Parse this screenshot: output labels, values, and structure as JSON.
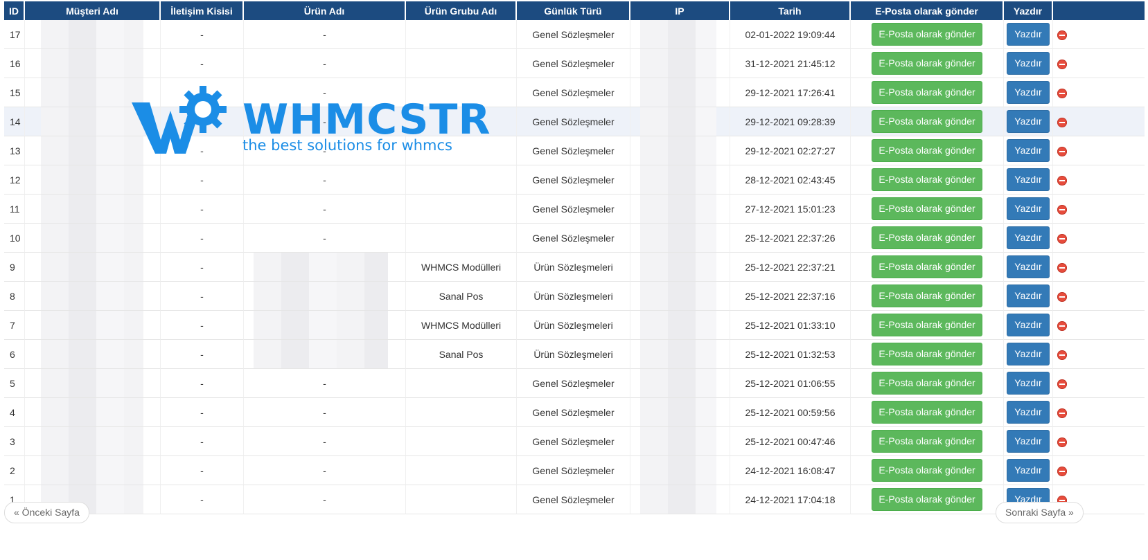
{
  "columns": [
    "ID",
    "Müşteri Adı",
    "İletişim Kisisi",
    "Ürün Adı",
    "Ürün Grubu Adı",
    "Günlük Türü",
    "IP",
    "Tarih",
    "E-Posta olarak gönder",
    "Yazdır",
    ""
  ],
  "rows": [
    {
      "id": "17",
      "contact": "-",
      "product": "-",
      "group": "",
      "type": "Genel Sözleşmeler",
      "date": "02-01-2022 19:09:44"
    },
    {
      "id": "16",
      "contact": "-",
      "product": "-",
      "group": "",
      "type": "Genel Sözleşmeler",
      "date": "31-12-2021 21:45:12"
    },
    {
      "id": "15",
      "contact": "-",
      "product": "-",
      "group": "",
      "type": "Genel Sözleşmeler",
      "date": "29-12-2021 17:26:41"
    },
    {
      "id": "14",
      "contact": "-",
      "product": "-",
      "group": "",
      "type": "Genel Sözleşmeler",
      "date": "29-12-2021 09:28:39"
    },
    {
      "id": "13",
      "contact": "-",
      "product": "-",
      "group": "",
      "type": "Genel Sözleşmeler",
      "date": "29-12-2021 02:27:27"
    },
    {
      "id": "12",
      "contact": "-",
      "product": "-",
      "group": "",
      "type": "Genel Sözleşmeler",
      "date": "28-12-2021 02:43:45"
    },
    {
      "id": "11",
      "contact": "-",
      "product": "-",
      "group": "",
      "type": "Genel Sözleşmeler",
      "date": "27-12-2021 15:01:23"
    },
    {
      "id": "10",
      "contact": "-",
      "product": "-",
      "group": "",
      "type": "Genel Sözleşmeler",
      "date": "25-12-2021 22:37:26"
    },
    {
      "id": "9",
      "contact": "-",
      "product": "",
      "group": "WHMCS Modülleri",
      "type": "Ürün Sözleşmeleri",
      "date": "25-12-2021 22:37:21"
    },
    {
      "id": "8",
      "contact": "-",
      "product": "",
      "group": "Sanal Pos",
      "type": "Ürün Sözleşmeleri",
      "date": "25-12-2021 22:37:16"
    },
    {
      "id": "7",
      "contact": "-",
      "product": "",
      "group": "WHMCS Modülleri",
      "type": "Ürün Sözleşmeleri",
      "date": "25-12-2021 01:33:10"
    },
    {
      "id": "6",
      "contact": "-",
      "product": "",
      "group": "Sanal Pos",
      "type": "Ürün Sözleşmeleri",
      "date": "25-12-2021 01:32:53"
    },
    {
      "id": "5",
      "contact": "-",
      "product": "-",
      "group": "",
      "type": "Genel Sözleşmeler",
      "date": "25-12-2021 01:06:55"
    },
    {
      "id": "4",
      "contact": "-",
      "product": "-",
      "group": "",
      "type": "Genel Sözleşmeler",
      "date": "25-12-2021 00:59:56"
    },
    {
      "id": "3",
      "contact": "-",
      "product": "-",
      "group": "",
      "type": "Genel Sözleşmeler",
      "date": "25-12-2021 00:47:46"
    },
    {
      "id": "2",
      "contact": "-",
      "product": "-",
      "group": "",
      "type": "Genel Sözleşmeler",
      "date": "24-12-2021 16:08:47"
    },
    {
      "id": "1",
      "contact": "-",
      "product": "-",
      "group": "",
      "type": "Genel Sözleşmeler",
      "date": "24-12-2021 17:04:18"
    }
  ],
  "highlighted_row": "14",
  "email_button_label": "E-Posta olarak gönder",
  "print_button_label": "Yazdır",
  "delete_icon": "minus-circle-icon",
  "pagination": {
    "prev_label": "« Önceki Sayfa",
    "next_label": "Sonraki Sayfa »"
  },
  "watermark": {
    "title": "WHMCSTR",
    "tagline": "the best solutions for whmcs"
  },
  "colors": {
    "header": "#1c4b80",
    "email_button": "#5cb85c",
    "print_button": "#337ab7",
    "delete": "#e74c3c",
    "watermark": "#1b8de6"
  }
}
